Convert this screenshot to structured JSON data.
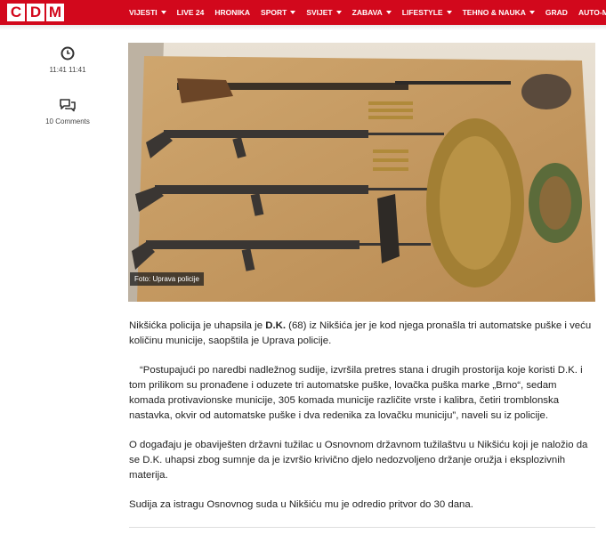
{
  "site": {
    "logo_letters": [
      "C",
      "D",
      "M"
    ],
    "brand_color": "#d2081c"
  },
  "nav": {
    "items": [
      {
        "label": "VIJESTI",
        "dropdown": true
      },
      {
        "label": "LIVE 24",
        "dropdown": false
      },
      {
        "label": "HRONIKA",
        "dropdown": false
      },
      {
        "label": "SPORT",
        "dropdown": true
      },
      {
        "label": "SVIJET",
        "dropdown": true
      },
      {
        "label": "ZABAVA",
        "dropdown": true
      },
      {
        "label": "LIFESTYLE",
        "dropdown": true
      },
      {
        "label": "TEHNO & NAUKA",
        "dropdown": true
      },
      {
        "label": "GRAD",
        "dropdown": false
      },
      {
        "label": "AUTO-MOTO",
        "dropdown": true
      }
    ]
  },
  "meta": {
    "time": "11:41 11:41",
    "time_icon": "clock-icon",
    "comments": "10 Comments",
    "comments_icon": "comments-icon"
  },
  "image": {
    "caption": "Foto: Uprava policije"
  },
  "article": {
    "p1_before": "Nikšićka policija je uhapsila je ",
    "p1_bold": "D.K.",
    "p1_after": " (68) iz Nikšića jer je kod njega pronašla tri automatske puške i veću količinu municije, saopštila je Uprava policije.",
    "p2": "“Postupajući po naredbi nadležnog sudije, izvršila pretres stana i drugih prostorija koje koristi D.K. i tom prilikom su pronađene i oduzete tri automatske puške, lovačka puška marke „Brno“, sedam komada protivavionske municije, 305 komada municije različite vrste i kalibra, četiri tromblonska nastavka, okvir od automatske puške i dva redenika za lovačku municiju”, naveli su iz policije.",
    "p3": "O događaju je obaviješten državni tužilac u Osnovnom državnom tužilaštvu u Nikšiću koji je naložio da se D.K. uhapsi zbog sumnje da je izvršio krivično djelo nedozvoljeno držanje oružja i eksplozivnih materija.",
    "p4": "Sudija za istragu Osnovnog suda u Nikšiću mu je odredio pritvor do 30 dana."
  }
}
